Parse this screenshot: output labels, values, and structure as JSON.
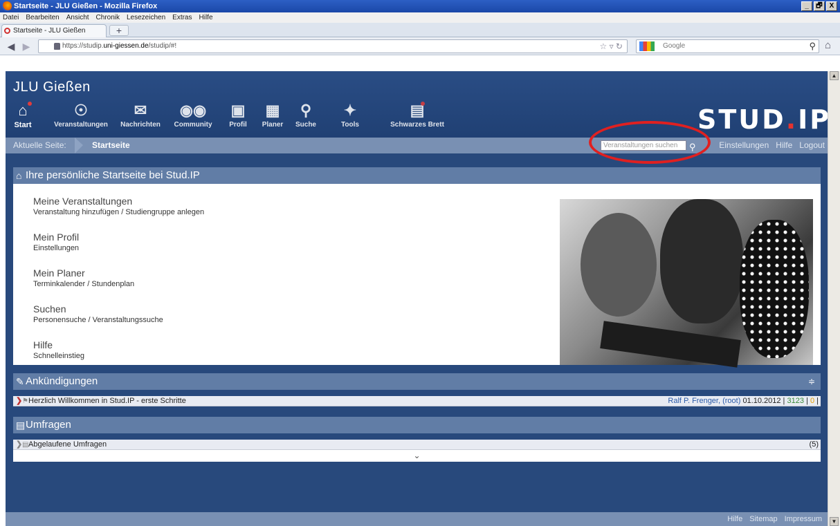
{
  "window": {
    "title": "Startseite - JLU Gießen - Mozilla Firefox",
    "controls": [
      "_",
      "🗗",
      "X"
    ]
  },
  "menu": [
    "Datei",
    "Bearbeiten",
    "Ansicht",
    "Chronik",
    "Lesezeichen",
    "Extras",
    "Hilfe"
  ],
  "tab": {
    "label": "Startseite - JLU Gießen",
    "new_label": "+"
  },
  "url": {
    "prefix": "https://studip.",
    "domain": "uni-giessen.de",
    "suffix": "/studip/#!"
  },
  "search_engine": {
    "placeholder": "Google"
  },
  "site": {
    "title": "JLU Gießen",
    "logo_main": "STUD",
    "logo_dot": ".",
    "logo_end": "IP"
  },
  "nav": [
    {
      "label": "Start",
      "icon": "home-icon"
    },
    {
      "label": "Veranstaltungen",
      "icon": "courses-icon"
    },
    {
      "label": "Nachrichten",
      "icon": "mail-icon"
    },
    {
      "label": "Community",
      "icon": "community-icon"
    },
    {
      "label": "Profil",
      "icon": "profile-icon"
    },
    {
      "label": "Planer",
      "icon": "calendar-icon"
    },
    {
      "label": "Suche",
      "icon": "search-icon"
    },
    {
      "label": "Tools",
      "icon": "wrench-icon"
    },
    {
      "label": "Schwarzes Brett",
      "icon": "board-icon"
    }
  ],
  "breadcrumb": {
    "label": "Aktuelle Seite:",
    "current": "Startseite"
  },
  "course_search": {
    "placeholder": "Veranstaltungen suchen"
  },
  "toplinks": [
    "Einstellungen",
    "Hilfe",
    "Logout"
  ],
  "home_panel": {
    "title": "Ihre persönliche Startseite bei Stud.IP"
  },
  "groups": [
    {
      "title": "Meine Veranstaltungen",
      "links": [
        "Veranstaltung hinzufügen",
        "Studiengruppe anlegen"
      ]
    },
    {
      "title": "Mein Profil",
      "links": [
        "Einstellungen"
      ]
    },
    {
      "title": "Mein Planer",
      "links": [
        "Terminkalender",
        "Stundenplan"
      ]
    },
    {
      "title": "Suchen",
      "links": [
        "Personensuche",
        "Veranstaltungssuche"
      ]
    },
    {
      "title": "Hilfe",
      "links": [
        "Schnelleinstieg"
      ]
    }
  ],
  "announcements": {
    "title": "Ankündigungen",
    "item": "Herzlich Willkommen in Stud.IP - erste Schritte",
    "author": "Ralf P. Frenger, (root)",
    "date": "01.10.2012",
    "views": "3123",
    "comments": "0"
  },
  "polls": {
    "title": "Umfragen",
    "item": "Abgelaufene Umfragen",
    "count": "(5)"
  },
  "footer": [
    "Hilfe",
    "Sitemap",
    "Impressum"
  ]
}
